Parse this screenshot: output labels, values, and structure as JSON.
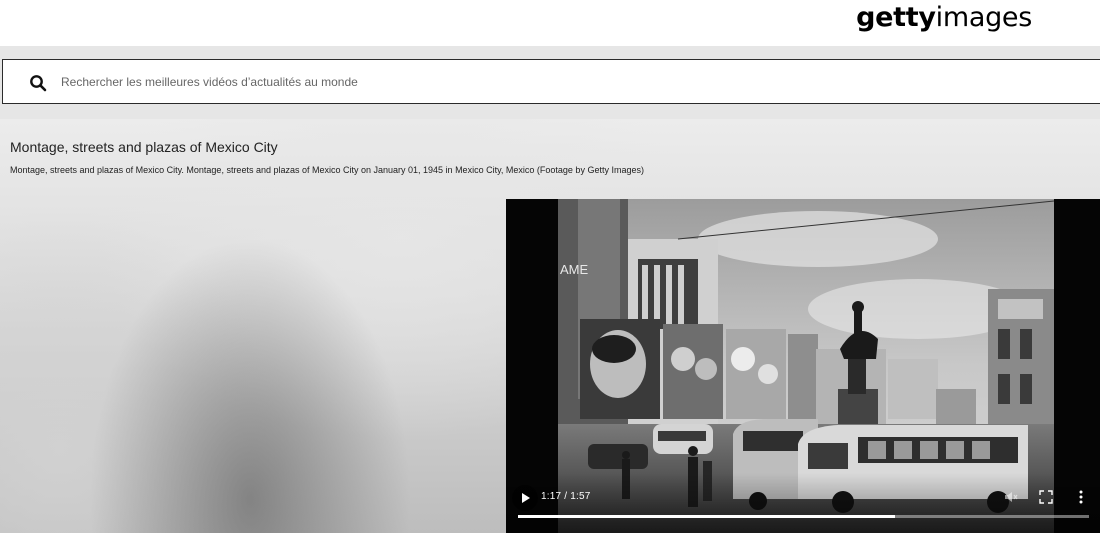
{
  "brand": {
    "logo_bold": "getty",
    "logo_light": "images"
  },
  "search": {
    "placeholder": "Rechercher les meilleures vidéos d’actualités au monde",
    "value": ""
  },
  "clip": {
    "title": "Montage, streets and plazas of Mexico City",
    "caption": "Montage, streets and plazas of Mexico City. Montage, streets and plazas of Mexico City on January 01, 1945 in Mexico City, Mexico (Footage by Getty Images)"
  },
  "player": {
    "time": "1:17 / 1:57",
    "progress": 0.66,
    "controls": {
      "play_icon": "play-icon",
      "mute_icon": "volume-muted-icon",
      "fullscreen_icon": "fullscreen-icon",
      "menu_icon": "more-options-icon"
    }
  }
}
